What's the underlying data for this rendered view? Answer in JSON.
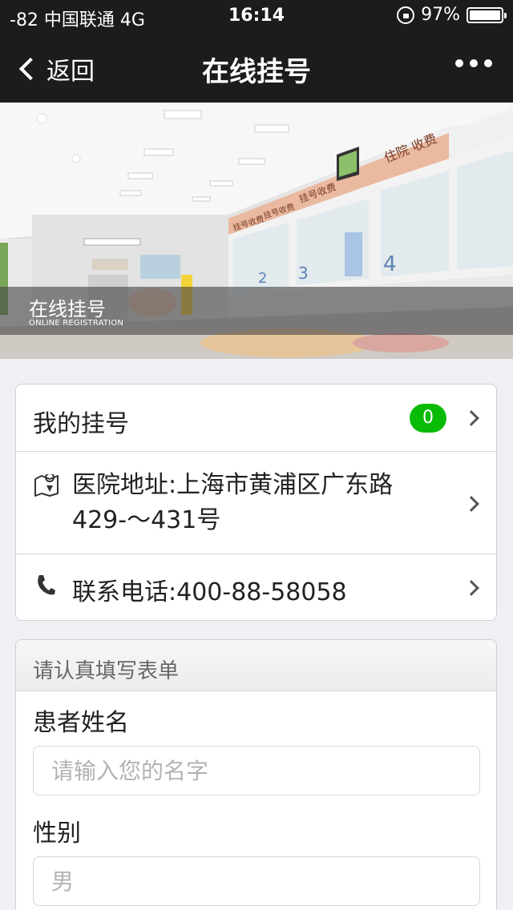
{
  "status_bar": {
    "carrier": "-82 中国联通  4G",
    "time": "16:14",
    "battery": "97%"
  },
  "nav": {
    "back_label": "返回",
    "title": "在线挂号"
  },
  "banner": {
    "title": "在线挂号",
    "subtitle": "ONLINE REGISTRATION",
    "signs": [
      "住院 收费",
      "挂号收费",
      "挂号收费",
      "挂号收费"
    ]
  },
  "info": {
    "my_registration_label": "我的挂号",
    "my_registration_count": "0",
    "address": "医院地址:上海市黄浦区广东路429-～431号",
    "phone": "联系电话:400-88-58058"
  },
  "form": {
    "header": "请认真填写表单",
    "name_label": "患者姓名",
    "name_placeholder": "请输入您的名字",
    "gender_label": "性别",
    "gender_placeholder": "男"
  },
  "colors": {
    "bar_bg": "#1c1c1e",
    "badge_green": "#09bb07",
    "page_bg": "#efeff4"
  }
}
